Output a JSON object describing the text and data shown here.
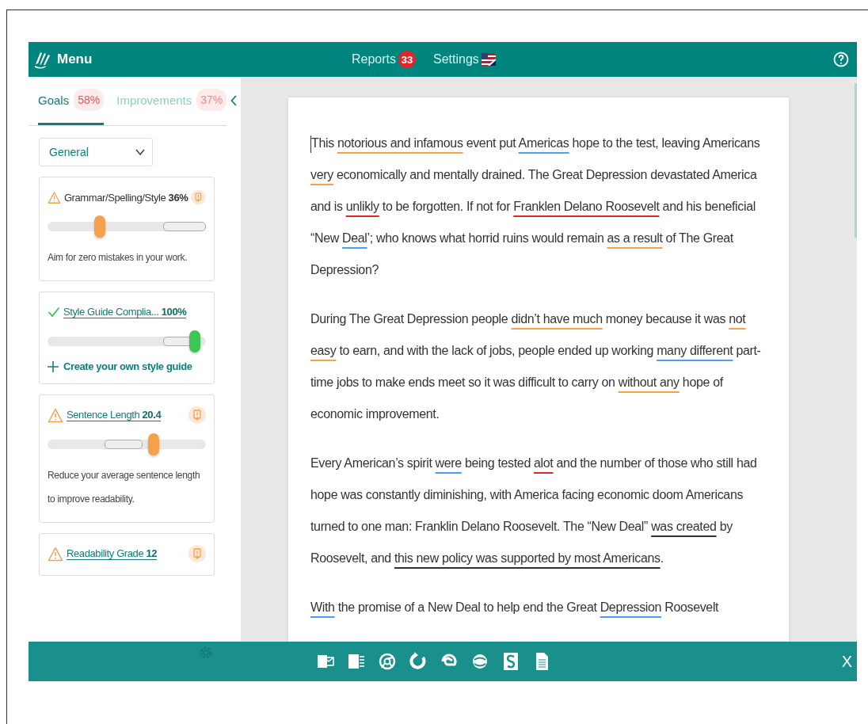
{
  "topbar": {
    "menu_label": "Menu",
    "nav": [
      {
        "label": "Reports",
        "badge": "33",
        "kind": "badge"
      },
      {
        "label": "Settings",
        "kind": "flag"
      }
    ]
  },
  "sidebar": {
    "tabs": [
      {
        "label": "Goals",
        "percent": "58%",
        "selected": true
      },
      {
        "label": "Improvements",
        "percent": "37%",
        "selected": false
      }
    ],
    "category_select": {
      "value": "General"
    },
    "cards": [
      {
        "kind": "warning",
        "title": "Grammar/Spelling/Style",
        "value": "36%",
        "linked": false,
        "level": 0.33,
        "description": "Aim for zero mistakes in your work."
      },
      {
        "kind": "ok",
        "title": "Style Guide Complia...",
        "value": "100%",
        "linked": true,
        "level": 0.93,
        "action": "Create your own style guide"
      },
      {
        "kind": "warning",
        "title": "Sentence Length",
        "value": "20.4",
        "linked": true,
        "level": 0.67,
        "description": "Reduce your average sentence length to improve readability."
      },
      {
        "kind": "warning",
        "title": "Readability Grade",
        "value": "12",
        "linked": true
      }
    ]
  },
  "document": {
    "paragraphs": [
      [
        {
          "text": "This "
        },
        {
          "text": "notorious and infamous",
          "kind": "style"
        },
        {
          "text": " event put "
        },
        {
          "text": "Americas",
          "kind": "grammar"
        },
        {
          "text": " hope to the test, leaving Americans "
        },
        {
          "text": "very",
          "kind": "style"
        },
        {
          "text": " economically and mentally drained. The Great Depression devastated America and is "
        },
        {
          "text": "unlikly",
          "kind": "spelling"
        },
        {
          "text": " to be forgotten. If not for "
        },
        {
          "text": "Franklen Delano Roosevelt",
          "kind": "spelling"
        },
        {
          "text": " and his beneficial “New "
        },
        {
          "text": "Deal",
          "kind": "grammar"
        },
        {
          "text": "’; who knows what horrid ruins would remain "
        },
        {
          "text": "as a result",
          "kind": "style"
        },
        {
          "text": " of The Great Depression?"
        }
      ],
      [
        {
          "text": "During The Great Depression people "
        },
        {
          "text": "didn’t have much",
          "kind": "style"
        },
        {
          "text": " money because it was "
        },
        {
          "text": "not easy",
          "kind": "style"
        },
        {
          "text": " to earn, and with the lack of jobs, people ended up working "
        },
        {
          "text": "many different",
          "kind": "grammar"
        },
        {
          "text": " part-time jobs to make ends meet so it was difficult to carry on "
        },
        {
          "text": "without any",
          "kind": "style"
        },
        {
          "text": " hope of economic improvement."
        }
      ],
      [
        {
          "text": "Every American’s spirit "
        },
        {
          "text": "were",
          "kind": "grammar"
        },
        {
          "text": " being tested "
        },
        {
          "text": "alot",
          "kind": "spelling"
        },
        {
          "text": " and the number of those who still had hope was constantly diminishing, with America facing economic doom Americans turned to one man: Franklin Delano Roosevelt. The “New Deal” "
        },
        {
          "text": "was created",
          "kind": "passive"
        },
        {
          "text": " by Roosevelt, and "
        },
        {
          "text": "this new policy was supported by most Americans",
          "kind": "passive"
        },
        {
          "text": "."
        }
      ],
      [
        {
          "text": "With",
          "kind": "grammar"
        },
        {
          "text": " the promise of a New Deal to help end the Great "
        },
        {
          "text": "Depression",
          "kind": "grammar"
        },
        {
          "text": " Roosevelt"
        }
      ]
    ]
  },
  "bottombar": {
    "close_label": "X"
  }
}
